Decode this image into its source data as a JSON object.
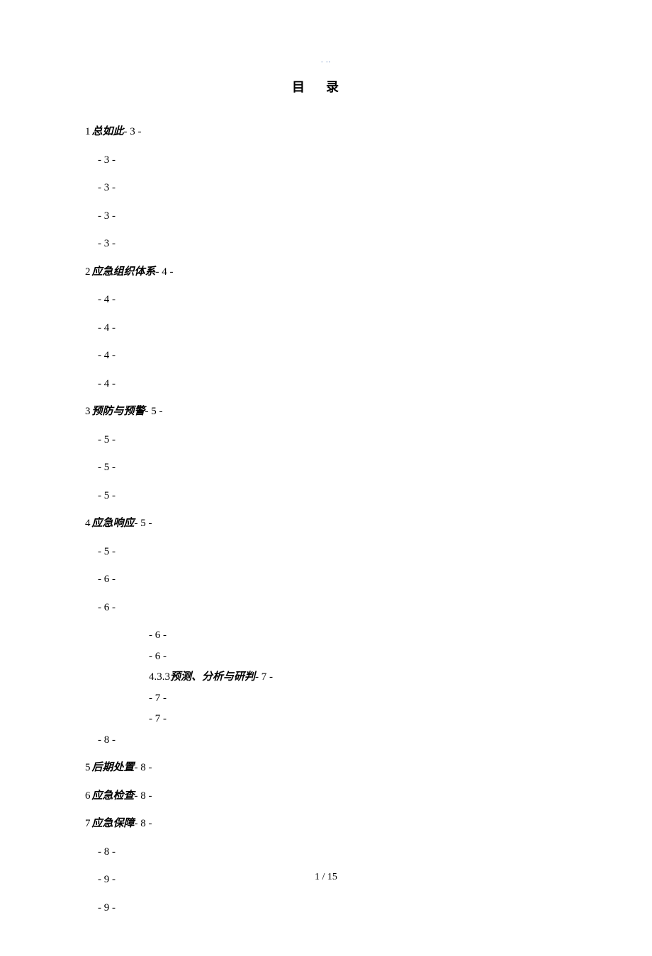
{
  "header_mark": ". ..",
  "title": "目录",
  "toc": [
    {
      "level": "section",
      "num": "1",
      "label": "总如此",
      "page": "- 3 -"
    },
    {
      "level": "sub",
      "page": "- 3 -"
    },
    {
      "level": "sub",
      "page": "- 3 -"
    },
    {
      "level": "sub",
      "page": "- 3 -"
    },
    {
      "level": "sub",
      "page": "- 3 -"
    },
    {
      "level": "section",
      "num": "2",
      "label": "应急组织体系",
      "page": "- 4 -"
    },
    {
      "level": "sub",
      "page": "- 4 -"
    },
    {
      "level": "sub",
      "page": "- 4 -"
    },
    {
      "level": "sub",
      "page": "- 4 -"
    },
    {
      "level": "sub",
      "page": "- 4 -"
    },
    {
      "level": "section",
      "num": "3",
      "label": "预防与预警",
      "page": "- 5 -"
    },
    {
      "level": "sub",
      "page": "- 5 -"
    },
    {
      "level": "sub",
      "page": "- 5 -"
    },
    {
      "level": "sub",
      "page": "- 5 -"
    },
    {
      "level": "section",
      "num": "4",
      "label": "应急响应",
      "page": "- 5 -"
    },
    {
      "level": "sub",
      "page": "- 5 -"
    },
    {
      "level": "sub",
      "page": "- 6 -"
    },
    {
      "level": "sub",
      "page": "- 6 -"
    },
    {
      "level": "subsub",
      "page": "- 6 -"
    },
    {
      "level": "subsub",
      "page": "- 6 -"
    },
    {
      "level": "subsub",
      "num": "4.3.3",
      "label": "预测、分析与研判",
      "page": "- 7 -"
    },
    {
      "level": "subsub",
      "page": "- 7 -"
    },
    {
      "level": "subsub",
      "page": "- 7 -"
    },
    {
      "level": "sub",
      "page": "- 8 -"
    },
    {
      "level": "section",
      "num": "5",
      "label": "后期处置",
      "page": "- 8 -"
    },
    {
      "level": "section",
      "num": "6",
      "label": "应急检查",
      "page": "- 8 -"
    },
    {
      "level": "section",
      "num": "7",
      "label": "应急保障",
      "page": "- 8 -"
    },
    {
      "level": "sub",
      "page": "- 8 -"
    },
    {
      "level": "sub",
      "page": "- 9 -"
    },
    {
      "level": "sub",
      "page": "- 9 -"
    }
  ],
  "footer": "1 / 15"
}
